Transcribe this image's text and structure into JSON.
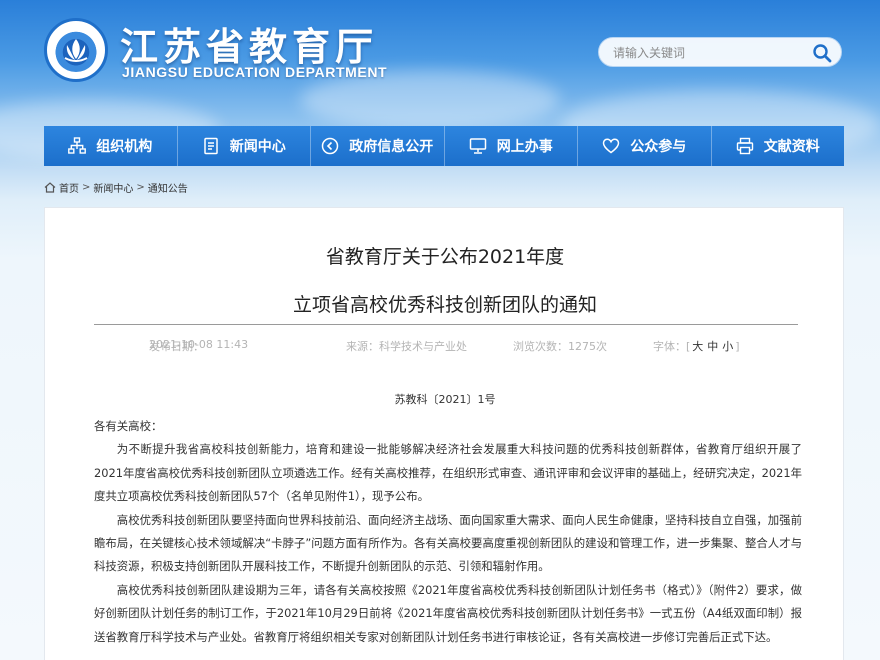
{
  "header": {
    "title": "江苏省教育厅",
    "subtitle": "JIANGSU EDUCATION DEPARTMENT",
    "emblem_icon": "lotus-emblem-icon",
    "search": {
      "placeholder": "请输入关键词",
      "icon": "search-icon"
    }
  },
  "nav": {
    "items": [
      {
        "label": "组织机构",
        "icon": "org-chart-icon"
      },
      {
        "label": "新闻中心",
        "icon": "document-icon"
      },
      {
        "label": "政府信息公开",
        "icon": "play-circle-icon"
      },
      {
        "label": "网上办事",
        "icon": "computer-icon"
      },
      {
        "label": "公众参与",
        "icon": "heart-icon"
      },
      {
        "label": "文献资料",
        "icon": "printer-icon"
      }
    ]
  },
  "breadcrumb": {
    "icon": "home-icon",
    "items": [
      "首页",
      "新闻中心",
      "通知公告"
    ],
    "separator": ">"
  },
  "article": {
    "title_line1": "省教育厅关于公布2021年度",
    "title_line2": "立项省高校优秀科技创新团队的通知",
    "meta": {
      "date_label": "发布日期：",
      "date": "2021-10-08 11:43",
      "source_label": "来源：",
      "source": "科学技术与产业处",
      "views_label": "浏览次数：",
      "views": "1275次",
      "font_label": "字体：",
      "bracket_open": "[",
      "bracket_close": "]",
      "font_sizes": [
        "大",
        "中",
        "小"
      ]
    },
    "doc_number": "苏教科〔2021〕1号",
    "salutation": "各有关高校：",
    "paragraphs": [
      "为不断提升我省高校科技创新能力，培育和建设一批能够解决经济社会发展重大科技问题的优秀科技创新群体，省教育厅组织开展了2021年度省高校优秀科技创新团队立项遴选工作。经有关高校推荐，在组织形式审查、通讯评审和会议评审的基础上，经研究决定，2021年度共立项高校优秀科技创新团队57个（名单见附件1），现予公布。",
      "高校优秀科技创新团队要坚持面向世界科技前沿、面向经济主战场、面向国家重大需求、面向人民生命健康，坚持科技自立自强，加强前瞻布局，在关键核心技术领域解决“卡脖子”问题方面有所作为。各有关高校要高度重视创新团队的建设和管理工作，进一步集聚、整合人才与科技资源，积极支持创新团队开展科技工作，不断提升创新团队的示范、引领和辐射作用。",
      "高校优秀科技创新团队建设期为三年，请各有关高校按照《2021年度省高校优秀科技创新团队计划任务书（格式）》（附件2）要求，做好创新团队计划任务的制订工作，于2021年10月29日前将《2021年度省高校优秀科技创新团队计划任务书》一式五份（A4纸双面印制）报送省教育厅科学技术与产业处。省教育厅将组织相关专家对创新团队计划任务书进行审核论证，各有关高校进一步修订完善后正式下达。"
    ]
  },
  "colors": {
    "nav_bg": "#1f73cf",
    "header_sky": "#2a7fd9",
    "title_text": "#222222",
    "meta_text": "#b4b4b4"
  }
}
